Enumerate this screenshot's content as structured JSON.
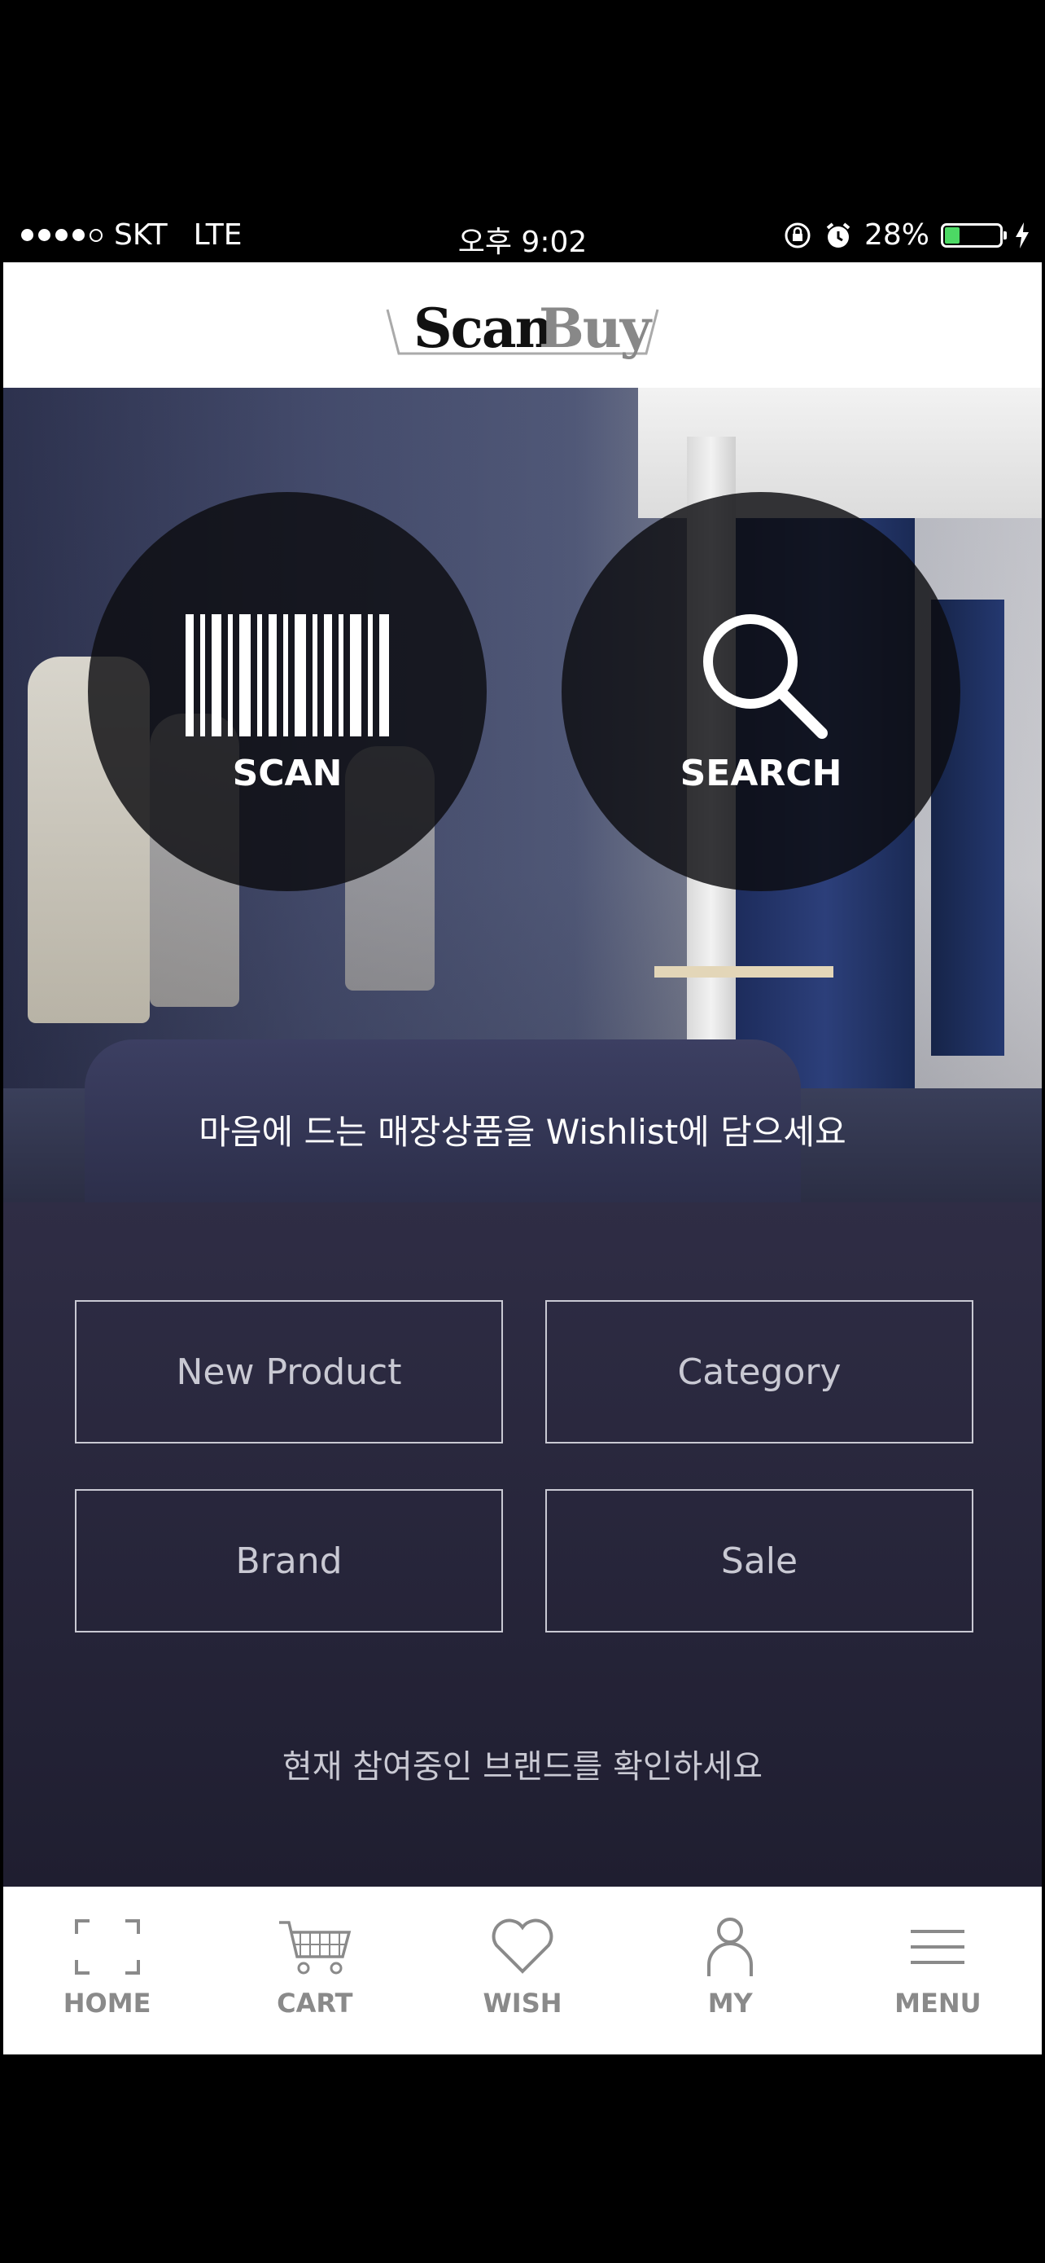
{
  "status_bar": {
    "carrier": "SKT",
    "network": "LTE",
    "time": "오후 9:02",
    "battery_percent": "28%",
    "battery_level": 0.28,
    "signal_bars": 4
  },
  "header": {
    "logo_part1": "Scan",
    "logo_part2": "Buy"
  },
  "hero": {
    "scan_label": "SCAN",
    "search_label": "SEARCH",
    "tagline": "마음에 드는 매장상품을 Wishlist에 담으세요"
  },
  "menu": {
    "new_product": "New Product",
    "category": "Category",
    "brand": "Brand",
    "sale": "Sale",
    "note": "현재 참여중인 브랜드를 확인하세요"
  },
  "tabs": [
    {
      "label": "HOME",
      "icon": "scan-frame-icon"
    },
    {
      "label": "CART",
      "icon": "cart-icon"
    },
    {
      "label": "WISH",
      "icon": "heart-icon"
    },
    {
      "label": "MY",
      "icon": "person-icon"
    },
    {
      "label": "MENU",
      "icon": "hamburger-icon"
    }
  ],
  "colors": {
    "panel": "#2f2d45",
    "panel_text": "#c9c9d3",
    "tab_text": "#8a8a8a",
    "battery_fill": "#4cd964"
  }
}
